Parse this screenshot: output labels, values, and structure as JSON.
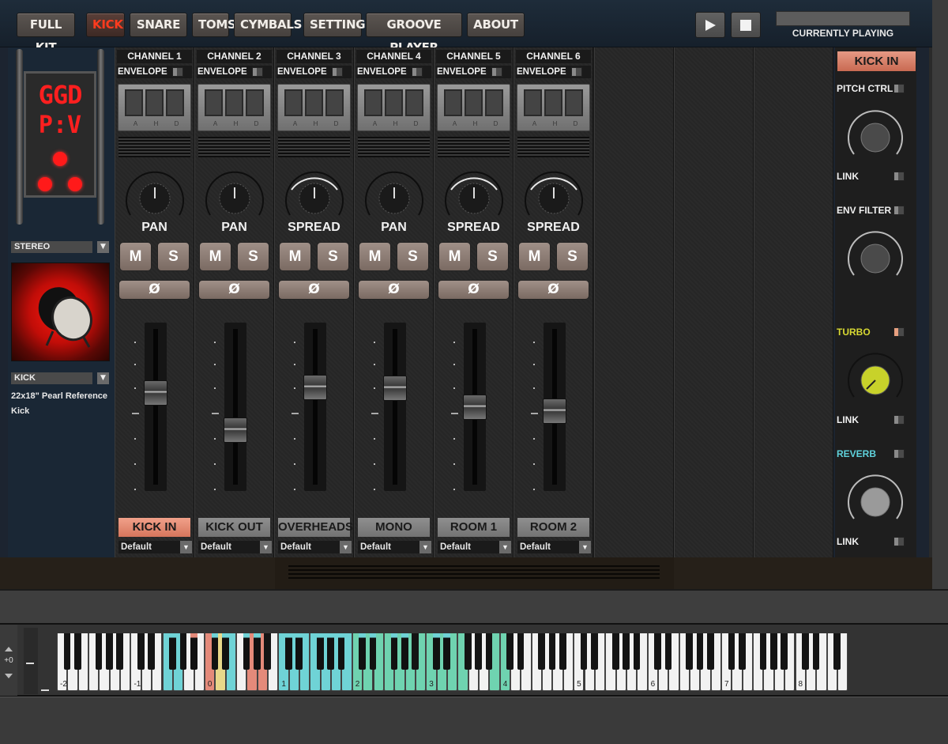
{
  "nav": {
    "tabs": [
      {
        "label": "FULL KIT",
        "active": false
      },
      {
        "label": "KICK",
        "active": true
      },
      {
        "label": "SNARE",
        "active": false
      },
      {
        "label": "TOMS",
        "active": false
      },
      {
        "label": "CYMBALS",
        "active": false
      },
      {
        "label": "SETTINGS",
        "active": false
      },
      {
        "label": "GROOVE PLAYER",
        "active": false
      },
      {
        "label": "ABOUT",
        "active": false
      }
    ],
    "now_playing_label": "CURRENTLY PLAYING"
  },
  "logo": {
    "line1": "GGD",
    "line2": "P:V"
  },
  "left_panel": {
    "output_mode": "STEREO",
    "instrument": "KICK",
    "description": "22x18\" Pearl Reference Kick"
  },
  "channels": [
    {
      "title": "CHANNEL 1",
      "envelope": "ENVELOPE",
      "knob": "PAN",
      "knob_ring": false,
      "fader_pos": 0.38,
      "output": "KICK IN",
      "active": true,
      "preset": "Default"
    },
    {
      "title": "CHANNEL 2",
      "envelope": "ENVELOPE",
      "knob": "PAN",
      "knob_ring": false,
      "fader_pos": 0.66,
      "output": "KICK OUT",
      "active": false,
      "preset": "Default"
    },
    {
      "title": "CHANNEL 3",
      "envelope": "ENVELOPE",
      "knob": "SPREAD",
      "knob_ring": true,
      "fader_pos": 0.34,
      "output": "OVERHEADS",
      "active": false,
      "preset": "Default"
    },
    {
      "title": "CHANNEL 4",
      "envelope": "ENVELOPE",
      "knob": "PAN",
      "knob_ring": false,
      "fader_pos": 0.35,
      "output": "MONO",
      "active": false,
      "preset": "Default"
    },
    {
      "title": "CHANNEL 5",
      "envelope": "ENVELOPE",
      "knob": "SPREAD",
      "knob_ring": true,
      "fader_pos": 0.49,
      "output": "ROOM 1",
      "active": false,
      "preset": "Default"
    },
    {
      "title": "CHANNEL 6",
      "envelope": "ENVELOPE",
      "knob": "SPREAD",
      "knob_ring": true,
      "fader_pos": 0.52,
      "output": "ROOM 2",
      "active": false,
      "preset": "Default"
    }
  ],
  "buttons": {
    "mute": "M",
    "solo": "S",
    "phase": "Ø"
  },
  "ahd_letters": [
    "A",
    "H",
    "D"
  ],
  "right_panel": {
    "title": "KICK IN",
    "pitch_ctrl": "PITCH CTRL",
    "env_filter": "ENV FILTER",
    "turbo": "TURBO",
    "reverb": "REVERB",
    "link": "LINK"
  },
  "keyboard": {
    "octave_shift": "+0",
    "octave_labels": [
      "-2",
      "-1",
      "0",
      "1",
      "2",
      "3",
      "4",
      "5",
      "6",
      "7",
      "8"
    ]
  },
  "colors": {
    "accent_red": "#ff3b1e",
    "active_salmon": "#e08f78",
    "turbo_yellow": "#c8d22a",
    "reverb_cyan": "#5fd2dc",
    "key_cyan": "#6fd3d6",
    "key_green": "#6fd3b0",
    "key_red": "#e48a7a",
    "key_yellow": "#e8d88a"
  }
}
